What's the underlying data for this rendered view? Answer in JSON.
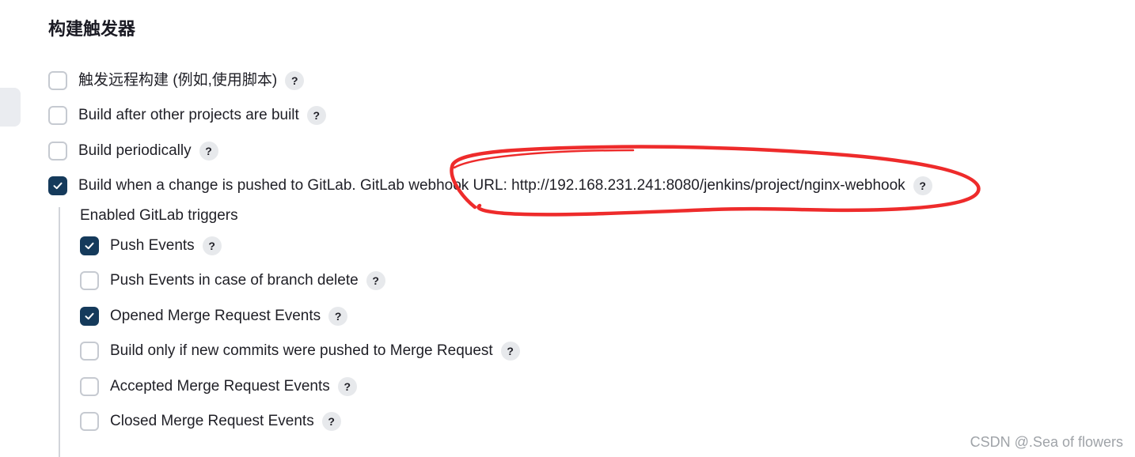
{
  "section": {
    "title": "构建触发器"
  },
  "triggers": [
    {
      "label": "触发远程构建 (例如,使用脚本)",
      "checked": false
    },
    {
      "label": "Build after other projects are built",
      "checked": false
    },
    {
      "label": "Build periodically",
      "checked": false
    },
    {
      "label": "Build when a change is pushed to GitLab. GitLab webhook URL: http://192.168.231.241:8080/jenkins/project/nginx-webhook",
      "checked": true
    }
  ],
  "gitlab": {
    "heading": "Enabled GitLab triggers",
    "options": [
      {
        "label": "Push Events",
        "checked": true
      },
      {
        "label": "Push Events in case of branch delete",
        "checked": false
      },
      {
        "label": "Opened Merge Request Events",
        "checked": true
      },
      {
        "label": "Build only if new commits were pushed to Merge Request",
        "checked": false
      },
      {
        "label": "Accepted Merge Request Events",
        "checked": false
      },
      {
        "label": "Closed Merge Request Events",
        "checked": false
      }
    ]
  },
  "help": {
    "glyph": "?"
  },
  "watermark": "CSDN @.Sea of flowers",
  "colors": {
    "checkbox_checked": "#153a5b",
    "annotation": "#ee2b2b"
  }
}
